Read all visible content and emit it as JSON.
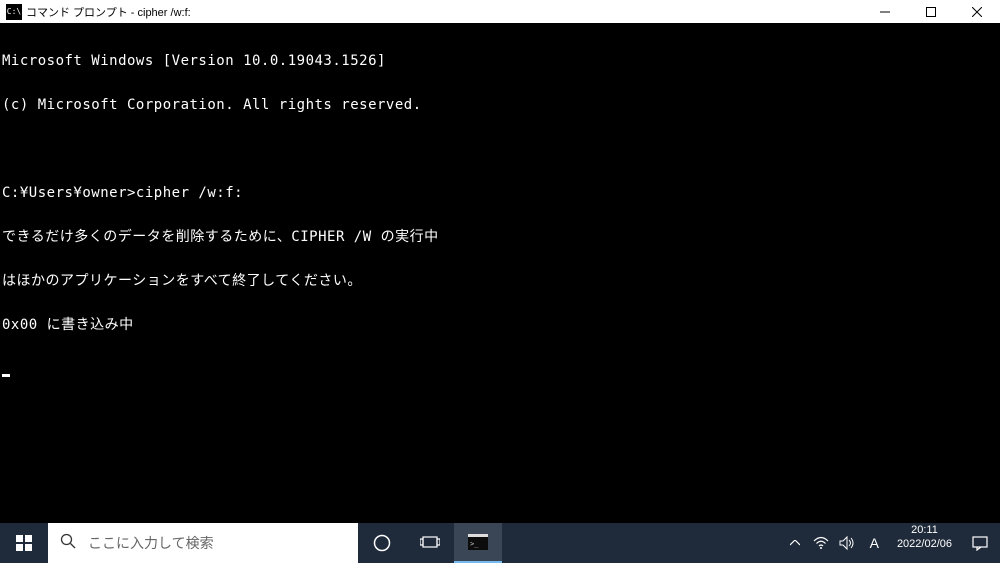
{
  "window": {
    "title": "コマンド プロンプト - cipher  /w:f:"
  },
  "terminal": {
    "lines": [
      "Microsoft Windows [Version 10.0.19043.1526]",
      "(c) Microsoft Corporation. All rights reserved.",
      "",
      "C:¥Users¥owner>cipher /w:f:",
      "できるだけ多くのデータを削除するために、CIPHER /W の実行中",
      "はほかのアプリケーションをすべて終了してください。",
      "0x00 に書き込み中"
    ]
  },
  "taskbar": {
    "search_placeholder": "ここに入力して検索",
    "ime": "A",
    "time": "20:11",
    "date": "2022/02/06"
  }
}
